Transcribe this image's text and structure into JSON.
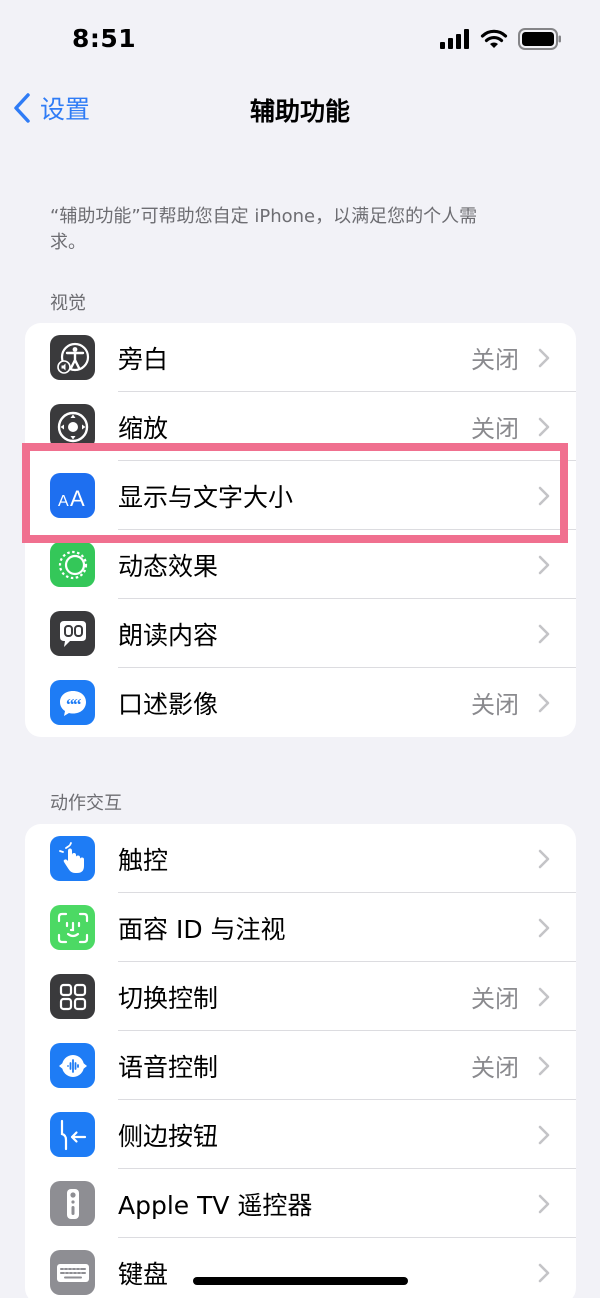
{
  "status_bar": {
    "time": "8:51"
  },
  "nav": {
    "back_label": "设置",
    "title": "辅助功能"
  },
  "intro_text": "“辅助功能”可帮助您自定 iPhone，以满足您的个人需求。",
  "sections": {
    "vision": {
      "header": "视觉",
      "items": [
        {
          "label": "旁白",
          "value": "关闭",
          "icon": "voiceover-icon",
          "color": "#3a3a3c"
        },
        {
          "label": "缩放",
          "value": "关闭",
          "icon": "zoom-icon",
          "color": "#3a3a3c"
        },
        {
          "label": "显示与文字大小",
          "value": "",
          "icon": "text-size-icon",
          "color": "#1e6ff0"
        },
        {
          "label": "动态效果",
          "value": "",
          "icon": "motion-icon",
          "color": "#34c759"
        },
        {
          "label": "朗读内容",
          "value": "",
          "icon": "spoken-content-icon",
          "color": "#3a3a3c"
        },
        {
          "label": "口述影像",
          "value": "关闭",
          "icon": "audio-description-icon",
          "color": "#1e7cf5"
        }
      ]
    },
    "interaction": {
      "header": "动作交互",
      "items": [
        {
          "label": "触控",
          "value": "",
          "icon": "touch-icon",
          "color": "#1e7cf5"
        },
        {
          "label": "面容 ID 与注视",
          "value": "",
          "icon": "face-id-icon",
          "color": "#4cd964"
        },
        {
          "label": "切换控制",
          "value": "关闭",
          "icon": "switch-control-icon",
          "color": "#3a3a3c"
        },
        {
          "label": "语音控制",
          "value": "关闭",
          "icon": "voice-control-icon",
          "color": "#1e7cf5"
        },
        {
          "label": "侧边按钮",
          "value": "",
          "icon": "side-button-icon",
          "color": "#1e7cf5"
        },
        {
          "label": "Apple TV 遥控器",
          "value": "",
          "icon": "apple-tv-remote-icon",
          "color": "#8e8e93"
        },
        {
          "label": "键盘",
          "value": "",
          "icon": "keyboard-icon",
          "color": "#8e8e93"
        }
      ]
    }
  },
  "colors": {
    "accent": "#2f7cf6",
    "highlight": "#f0708f",
    "background": "#f2f2f7"
  }
}
